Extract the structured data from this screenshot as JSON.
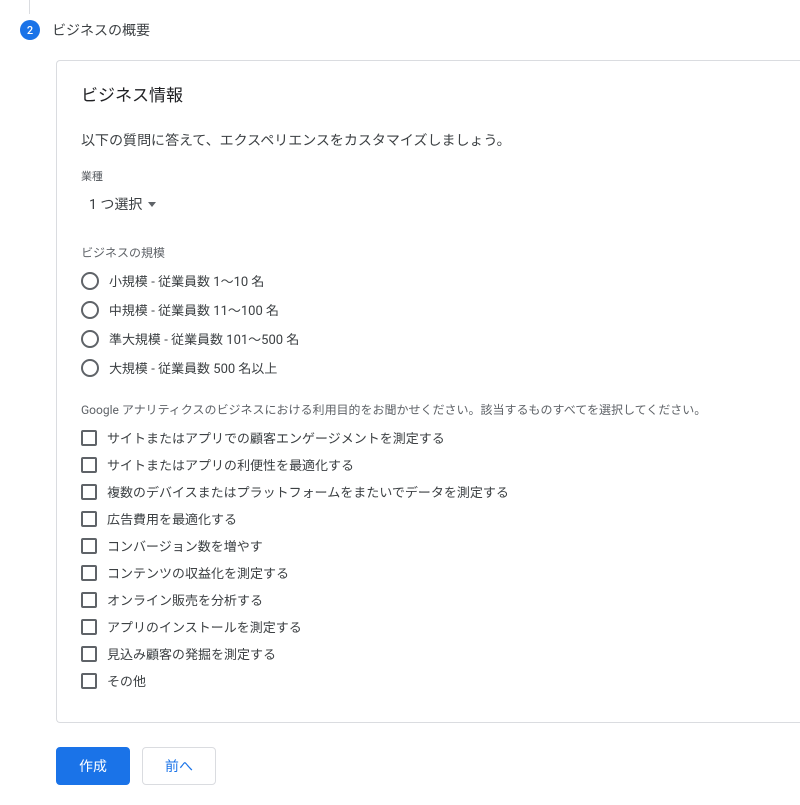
{
  "step": {
    "number": "2",
    "title": "ビジネスの概要"
  },
  "card": {
    "title": "ビジネス情報",
    "intro": "以下の質問に答えて、エクスペリエンスをカスタマイズしましょう。"
  },
  "industry": {
    "label": "業種",
    "selected": "1 つ選択"
  },
  "size": {
    "label": "ビジネスの規模",
    "options": [
      "小規模 - 従業員数 1～10 名",
      "中規模 - 従業員数 11～100 名",
      "準大規模 - 従業員数 101～500 名",
      "大規模 - 従業員数 500 名以上"
    ]
  },
  "purpose": {
    "label": "Google アナリティクスのビジネスにおける利用目的をお聞かせください。該当するものすべてを選択してください。",
    "options": [
      "サイトまたはアプリでの顧客エンゲージメントを測定する",
      "サイトまたはアプリの利便性を最適化する",
      "複数のデバイスまたはプラットフォームをまたいでデータを測定する",
      "広告費用を最適化する",
      "コンバージョン数を増やす",
      "コンテンツの収益化を測定する",
      "オンライン販売を分析する",
      "アプリのインストールを測定する",
      "見込み顧客の発掘を測定する",
      "その他"
    ]
  },
  "buttons": {
    "create": "作成",
    "previous": "前へ"
  }
}
